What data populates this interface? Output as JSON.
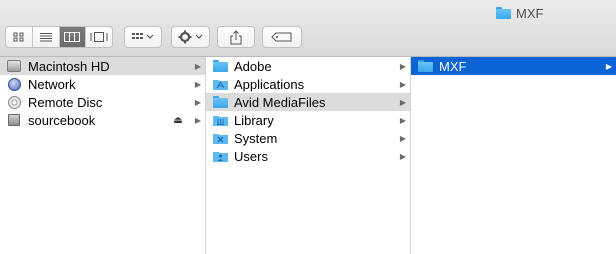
{
  "window": {
    "title": "MXF",
    "title_icon": "folder-icon"
  },
  "toolbar": {
    "view_buttons": [
      "icon-view",
      "list-view",
      "column-view",
      "gallery-view"
    ],
    "active_view": "column-view",
    "group_button": "group-menu",
    "action_button": "gear-menu",
    "share_button": "share",
    "tag_button": "tag"
  },
  "columns": [
    {
      "items": [
        {
          "label": "Macintosh HD",
          "icon": "hard-disk-icon",
          "selected": "gray",
          "chevron": "▶"
        },
        {
          "label": "Network",
          "icon": "network-globe-icon",
          "chevron": "▶"
        },
        {
          "label": "Remote Disc",
          "icon": "optical-disc-icon",
          "chevron": "▶"
        },
        {
          "label": "sourcebook",
          "icon": "usb-drive-icon",
          "eject": "⏏",
          "chevron": "▶"
        }
      ]
    },
    {
      "items": [
        {
          "label": "Adobe",
          "icon": "folder-icon",
          "chevron": "▶"
        },
        {
          "label": "Applications",
          "icon": "applications-folder-icon",
          "chevron": "▶"
        },
        {
          "label": "Avid MediaFiles",
          "icon": "folder-icon",
          "selected": "gray",
          "chevron": "▶"
        },
        {
          "label": "Library",
          "icon": "library-folder-icon",
          "chevron": "▶"
        },
        {
          "label": "System",
          "icon": "system-folder-icon",
          "chevron": "▶"
        },
        {
          "label": "Users",
          "icon": "users-folder-icon",
          "chevron": "▶"
        }
      ]
    },
    {
      "items": [
        {
          "label": "MXF",
          "icon": "folder-icon",
          "selected": "blue",
          "chevron": "▶"
        }
      ]
    }
  ],
  "colors": {
    "selection_blue": "#0b63d6",
    "selection_gray": "#dcdcdc",
    "folder_blue": "#3aa6ea"
  }
}
